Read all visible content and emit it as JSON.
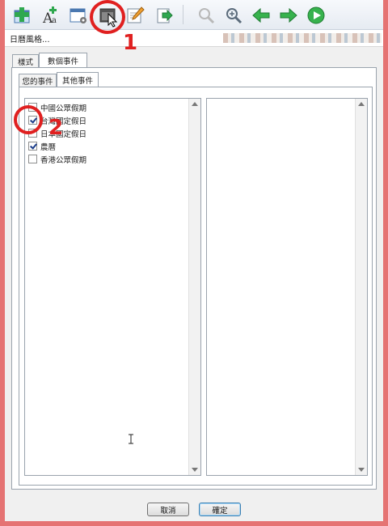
{
  "window": {
    "title": "日曆風格..."
  },
  "tabs": {
    "outer": [
      {
        "label": "樣式",
        "active": false
      },
      {
        "label": "數個事件",
        "active": true
      }
    ],
    "inner": [
      {
        "label": "您的事件",
        "active": false
      },
      {
        "label": "其他事件",
        "active": true
      }
    ]
  },
  "calendars": [
    {
      "label": "中國公眾假期",
      "checked": false
    },
    {
      "label": "台灣國定假日",
      "checked": true
    },
    {
      "label": "日本國定假日",
      "checked": false
    },
    {
      "label": "農曆",
      "checked": true
    },
    {
      "label": "香港公眾假期",
      "checked": false
    }
  ],
  "buttons": {
    "cancel": "取消",
    "ok": "確定"
  },
  "annotations": {
    "step1": "1",
    "step2": "2",
    "color": "#e02020"
  },
  "toolbar_icons": [
    "add-event-icon",
    "font-icon",
    "calendar-settings-icon",
    "calendar-style-icon",
    "edit-icon",
    "export-icon",
    "zoom-out-icon",
    "zoom-in-icon",
    "back-arrow-icon",
    "forward-arrow-icon",
    "play-icon"
  ]
}
